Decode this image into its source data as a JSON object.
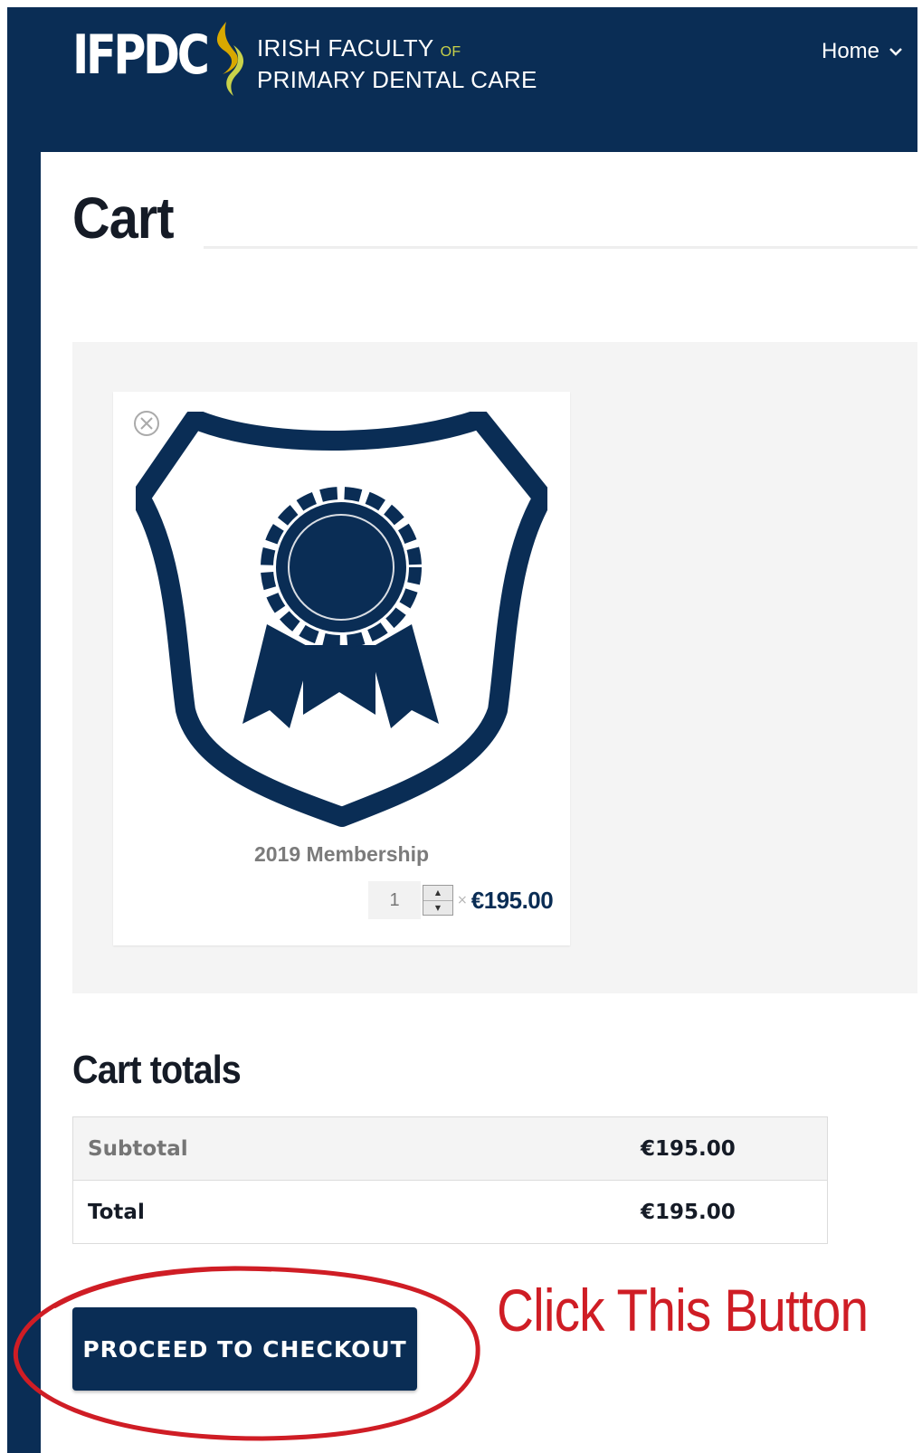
{
  "header": {
    "logo_acronym": "IFPDC",
    "logo_line1": "IRISH FACULTY",
    "logo_of": "OF",
    "logo_line2": "PRIMARY DENTAL CARE",
    "nav_home_label": "Home",
    "background_color": "#0a2d55",
    "accent_color": "#c9d24a"
  },
  "page": {
    "title": "Cart"
  },
  "cart": {
    "items": [
      {
        "name": "2019 Membership",
        "quantity": "1",
        "times_symbol": "×",
        "price": "€195.00",
        "image_icon": "membership-shield-rosette-icon",
        "remove_icon": "remove-circle-x-icon"
      }
    ]
  },
  "totals": {
    "heading": "Cart totals",
    "rows": [
      {
        "label": "Subtotal",
        "value": "€195.00"
      },
      {
        "label": "Total",
        "value": "€195.00"
      }
    ]
  },
  "checkout": {
    "button_label": "PROCEED TO CHECKOUT"
  },
  "annotation": {
    "text": "Click This Button",
    "color": "#cf1d25"
  }
}
